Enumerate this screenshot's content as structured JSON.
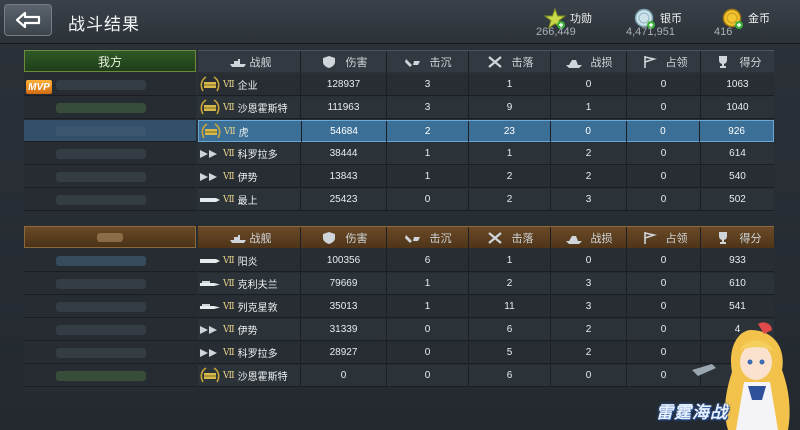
{
  "header": {
    "title": "战斗结果",
    "currencies": [
      {
        "label": "功勋",
        "value": "266,449",
        "icon": "star-merit-icon",
        "color": "#c8d94a"
      },
      {
        "label": "银币",
        "value": "4,471,951",
        "icon": "silver-coin-icon",
        "color": "#9fc7d6"
      },
      {
        "label": "金币",
        "value": "416",
        "icon": "gold-coin-icon",
        "color": "#e0b92a"
      }
    ]
  },
  "ally": {
    "tab_label": "我方",
    "mvp_label": "MVP",
    "columns": [
      "战舰",
      "伤害",
      "击沉",
      "击落",
      "战损",
      "占领",
      "得分"
    ],
    "rows": [
      {
        "ship_type": "carrier",
        "rank": "Ⅶ",
        "ship": "企业",
        "damage": "128937",
        "sink": "3",
        "down": "1",
        "damaged": "0",
        "occupy": "0",
        "score": "1063",
        "highlight": false
      },
      {
        "ship_type": "carrier",
        "rank": "Ⅶ",
        "ship": "沙恩霍斯特",
        "damage": "111963",
        "sink": "3",
        "down": "9",
        "damaged": "1",
        "occupy": "0",
        "score": "1040",
        "highlight": false
      },
      {
        "ship_type": "carrier",
        "rank": "Ⅶ",
        "ship": "虎",
        "damage": "54684",
        "sink": "2",
        "down": "23",
        "damaged": "0",
        "occupy": "0",
        "score": "926",
        "highlight": true
      },
      {
        "ship_type": "cruiser",
        "rank": "Ⅶ",
        "ship": "科罗拉多",
        "damage": "38444",
        "sink": "1",
        "down": "1",
        "damaged": "2",
        "occupy": "0",
        "score": "614",
        "highlight": false
      },
      {
        "ship_type": "cruiser",
        "rank": "Ⅶ",
        "ship": "伊势",
        "damage": "13843",
        "sink": "1",
        "down": "2",
        "damaged": "2",
        "occupy": "0",
        "score": "540",
        "highlight": false
      },
      {
        "ship_type": "destroyer",
        "rank": "Ⅶ",
        "ship": "最上",
        "damage": "25423",
        "sink": "0",
        "down": "2",
        "damaged": "3",
        "occupy": "0",
        "score": "502",
        "highlight": false
      }
    ]
  },
  "enemy": {
    "columns": [
      "战舰",
      "伤害",
      "击沉",
      "击落",
      "战损",
      "占领",
      "得分"
    ],
    "rows": [
      {
        "ship_type": "destroyer",
        "rank": "Ⅶ",
        "ship": "阳炎",
        "damage": "100356",
        "sink": "6",
        "down": "1",
        "damaged": "0",
        "occupy": "0",
        "score": "933"
      },
      {
        "ship_type": "light",
        "rank": "Ⅶ",
        "ship": "克利夫兰",
        "damage": "79669",
        "sink": "1",
        "down": "2",
        "damaged": "3",
        "occupy": "0",
        "score": "610"
      },
      {
        "ship_type": "light",
        "rank": "Ⅶ",
        "ship": "列克星敦",
        "damage": "35013",
        "sink": "1",
        "down": "11",
        "damaged": "3",
        "occupy": "0",
        "score": "541"
      },
      {
        "ship_type": "cruiser",
        "rank": "Ⅶ",
        "ship": "伊势",
        "damage": "31339",
        "sink": "0",
        "down": "6",
        "damaged": "2",
        "occupy": "0",
        "score": "4"
      },
      {
        "ship_type": "cruiser",
        "rank": "Ⅶ",
        "ship": "科罗拉多",
        "damage": "28927",
        "sink": "0",
        "down": "5",
        "damaged": "2",
        "occupy": "0",
        "score": ""
      },
      {
        "ship_type": "carrier",
        "rank": "Ⅶ",
        "ship": "沙恩霍斯特",
        "damage": "0",
        "sink": "0",
        "down": "6",
        "damaged": "0",
        "occupy": "0",
        "score": ""
      }
    ]
  },
  "logo": {
    "text": "雷霆海战"
  }
}
